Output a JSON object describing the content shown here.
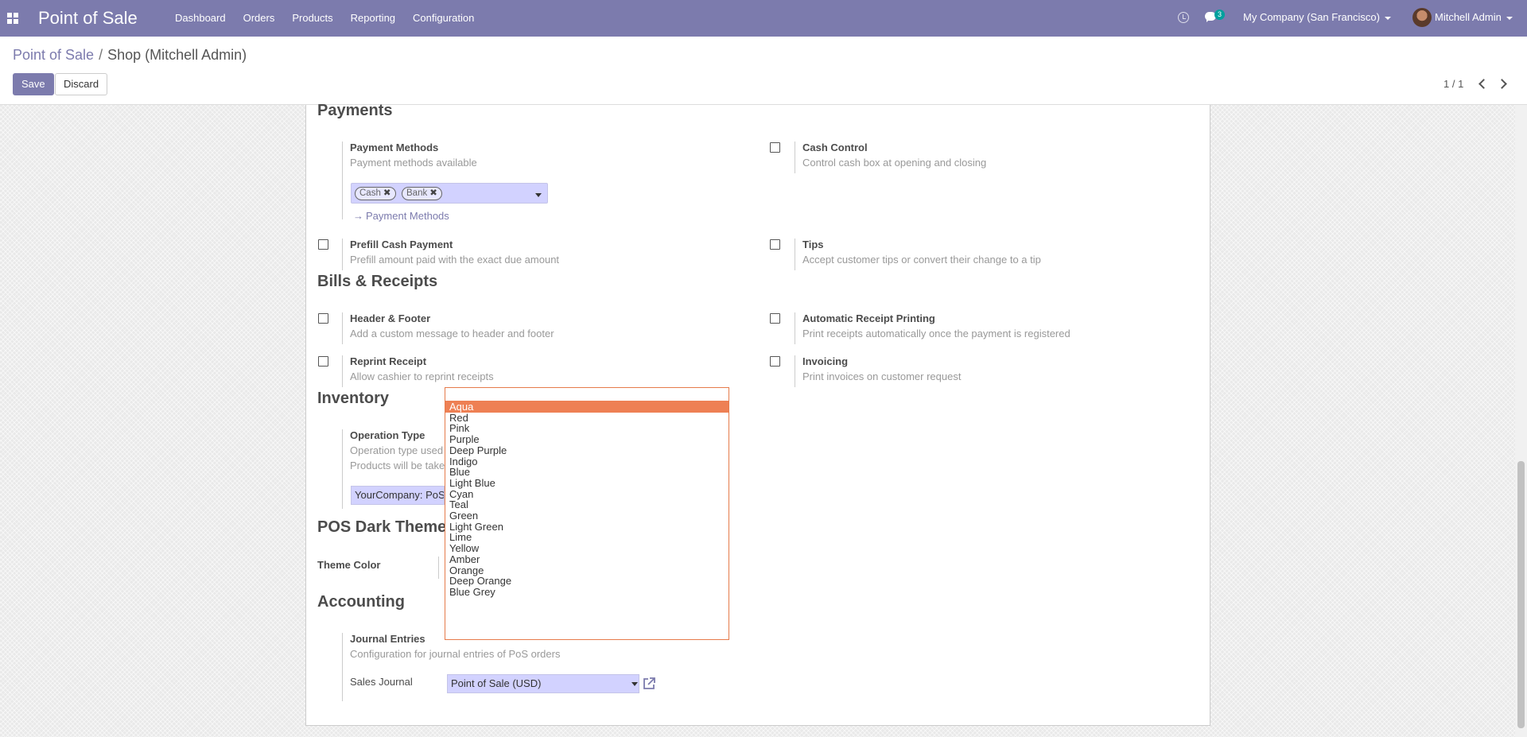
{
  "navbar": {
    "brand": "Point of Sale",
    "menu": [
      "Dashboard",
      "Orders",
      "Products",
      "Reporting",
      "Configuration"
    ],
    "chat_badge": "3",
    "company": "My Company (San Francisco)",
    "user": "Mitchell Admin",
    "bg_color": "#7c7bad"
  },
  "breadcrumb": {
    "parent": "Point of Sale",
    "separator": "/",
    "current": "Shop (Mitchell Admin)"
  },
  "actions": {
    "save": "Save",
    "discard": "Discard"
  },
  "pager": {
    "value": "1 / 1"
  },
  "sections": {
    "payments": "Payments",
    "bills": "Bills & Receipts",
    "inventory": "Inventory",
    "theme": "POS Dark Theme",
    "accounting": "Accounting"
  },
  "settings": {
    "payment_methods": {
      "label": "Payment Methods",
      "desc": "Payment methods available",
      "tags": [
        "Cash",
        "Bank"
      ],
      "link": "Payment Methods"
    },
    "cash_control": {
      "label": "Cash Control",
      "desc": "Control cash box at opening and closing"
    },
    "prefill_cash": {
      "label": "Prefill Cash Payment",
      "desc": "Prefill amount paid with the exact due amount"
    },
    "tips": {
      "label": "Tips",
      "desc": "Accept customer tips or convert their change to a tip"
    },
    "header_footer": {
      "label": "Header & Footer",
      "desc": "Add a custom message to header and footer"
    },
    "auto_receipt": {
      "label": "Automatic Receipt Printing",
      "desc": "Print receipts automatically once the payment is registered"
    },
    "reprint": {
      "label": "Reprint Receipt",
      "desc": "Allow cashier to reprint receipts"
    },
    "invoicing": {
      "label": "Invoicing",
      "desc": "Print invoices on customer request"
    },
    "operation_type": {
      "label": "Operation Type",
      "desc1": "Operation type used",
      "desc2": "Products will be take",
      "value": "YourCompany: PoS"
    },
    "theme_color": {
      "label": "Theme Color"
    },
    "journal_entries": {
      "label": "Journal Entries",
      "desc": "Configuration for journal entries of PoS orders"
    },
    "sales_journal": {
      "label": "Sales Journal",
      "value": "Point of Sale (USD)"
    }
  },
  "theme_dropdown": {
    "selected": "Aqua",
    "options": [
      "Aqua",
      "Red",
      "Pink",
      "Purple",
      "Deep Purple",
      "Indigo",
      "Blue",
      "Light Blue",
      "Cyan",
      "Teal",
      "Green",
      "Light Green",
      "Lime",
      "Yellow",
      "Amber",
      "Orange",
      "Deep Orange",
      "Blue Grey"
    ],
    "highlight_color": "#ee8054",
    "border_color": "#e67b4b"
  }
}
